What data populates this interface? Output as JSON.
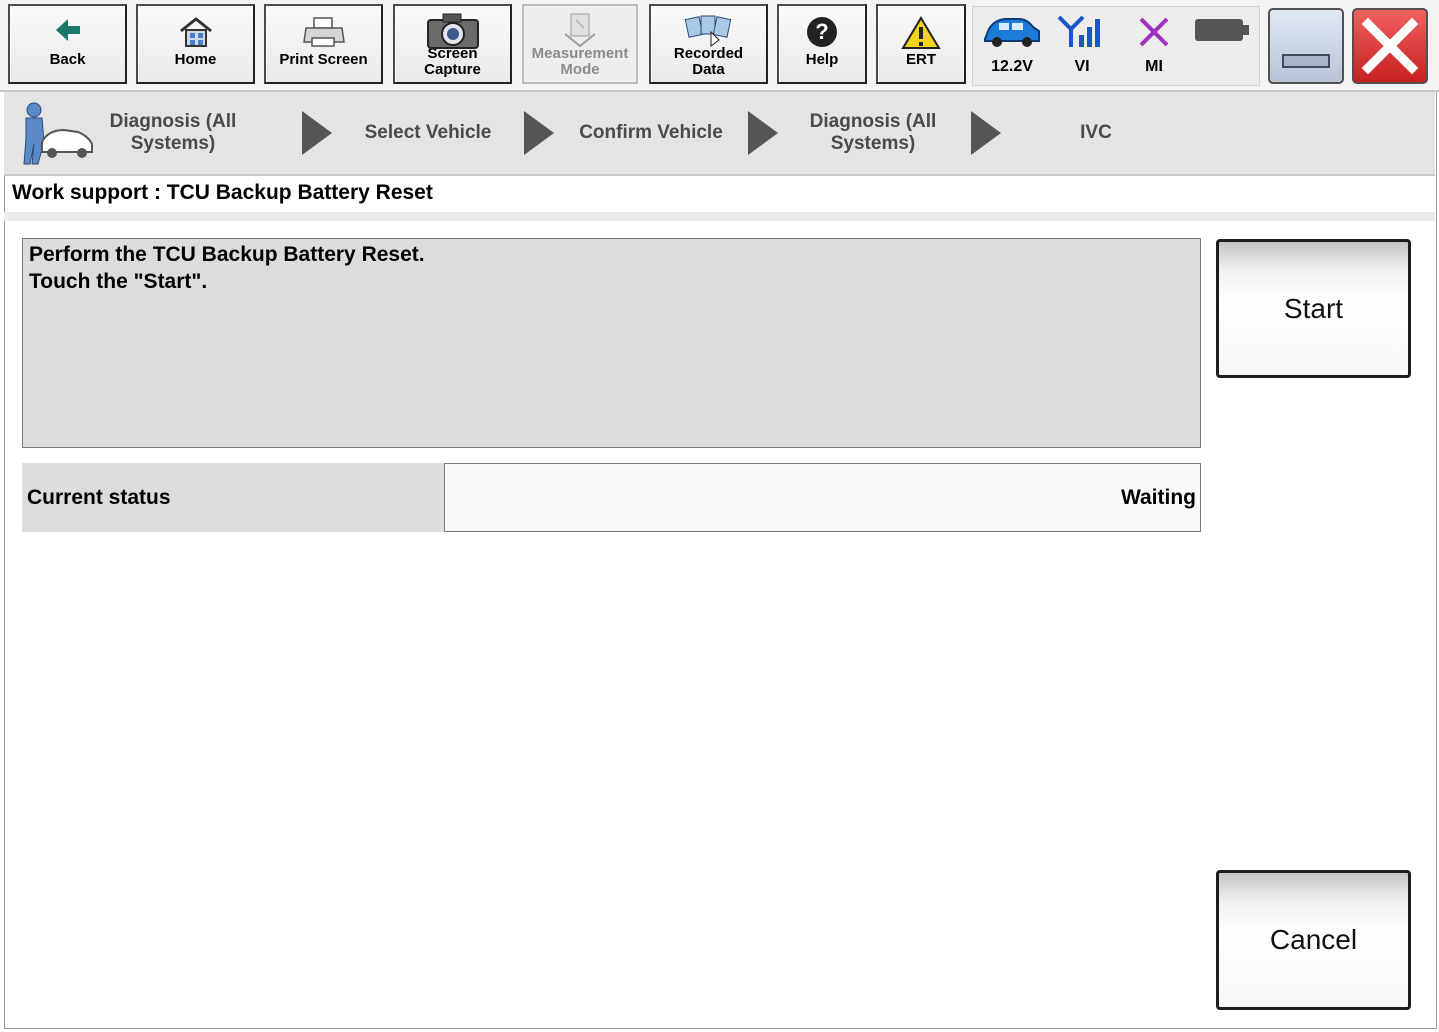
{
  "toolbar": {
    "back": "Back",
    "home": "Home",
    "print_screen": "Print Screen",
    "screen_capture": "Screen Capture",
    "measurement_mode": "Measurement Mode",
    "recorded_data": "Recorded Data",
    "help": "Help",
    "ert": "ERT"
  },
  "status": {
    "voltage": "12.2V",
    "vi": "VI",
    "mi": "MI"
  },
  "breadcrumb": {
    "step1": "Diagnosis (All Systems)",
    "step2": "Select Vehicle",
    "step3": "Confirm Vehicle",
    "step4": "Diagnosis (All Systems)",
    "step5": "IVC"
  },
  "page": {
    "title": "Work support : TCU Backup Battery Reset",
    "message_line1": "Perform the TCU Backup Battery Reset.",
    "message_line2": "Touch the \"Start\".",
    "status_label": "Current status",
    "status_value": "Waiting",
    "start": "Start",
    "cancel": "Cancel"
  },
  "colors": {
    "accent_teal": "#1a7a6a",
    "vi_blue": "#1a56c8",
    "mi_purple": "#a030c0",
    "close_red": "#d42a2a"
  }
}
